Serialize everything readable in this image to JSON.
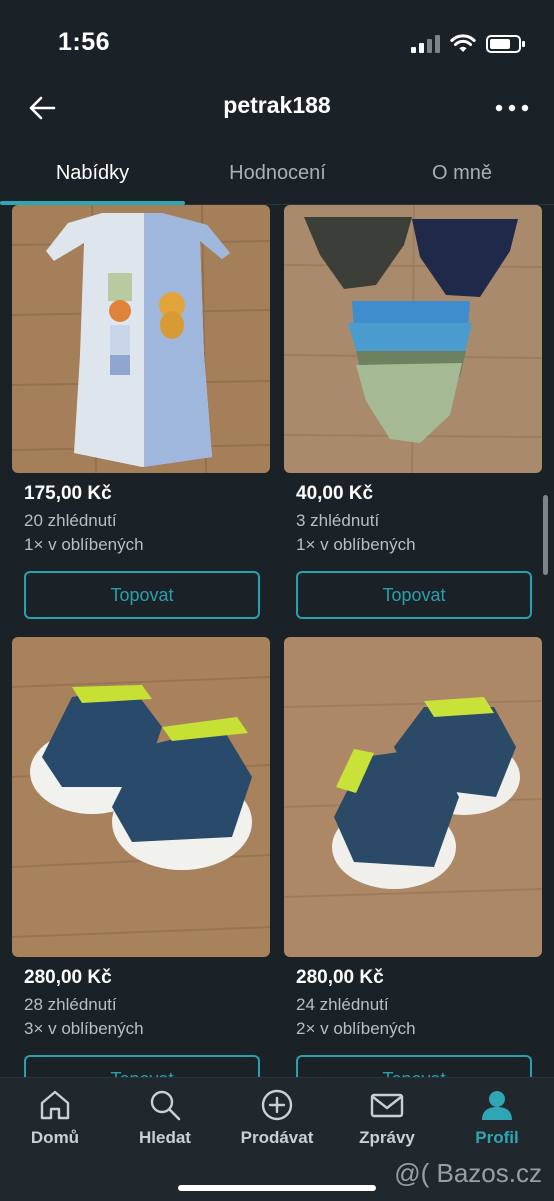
{
  "status": {
    "time": "1:56"
  },
  "header": {
    "title": "petrak188"
  },
  "tabs": [
    {
      "label": "Nabídky"
    },
    {
      "label": "Hodnocení"
    },
    {
      "label": "O mně"
    }
  ],
  "listings": [
    {
      "price": "175,00 Kč",
      "views": "20 zhlédnutí",
      "favs": "1× v oblíbených",
      "button": "Topovat"
    },
    {
      "price": "40,00 Kč",
      "views": "3 zhlédnutí",
      "favs": "1× v oblíbených",
      "button": "Topovat"
    },
    {
      "price": "280,00 Kč",
      "views": "28 zhlédnutí",
      "favs": "3× v oblíbených",
      "button": "Topovat"
    },
    {
      "price": "280,00 Kč",
      "views": "24 zhlédnutí",
      "favs": "2× v oblíbených",
      "button": "Topovat"
    }
  ],
  "bottom_nav": [
    {
      "label": "Domů",
      "icon": "home-icon"
    },
    {
      "label": "Hledat",
      "icon": "search-icon"
    },
    {
      "label": "Prodávat",
      "icon": "plus-circle-icon"
    },
    {
      "label": "Zprávy",
      "icon": "mail-icon"
    },
    {
      "label": "Profil",
      "icon": "user-icon"
    }
  ],
  "watermark": "@( Bazos.cz",
  "colors": {
    "background": "#1b2227",
    "accent": "#2fa6b3",
    "nav_background": "#20282d"
  }
}
